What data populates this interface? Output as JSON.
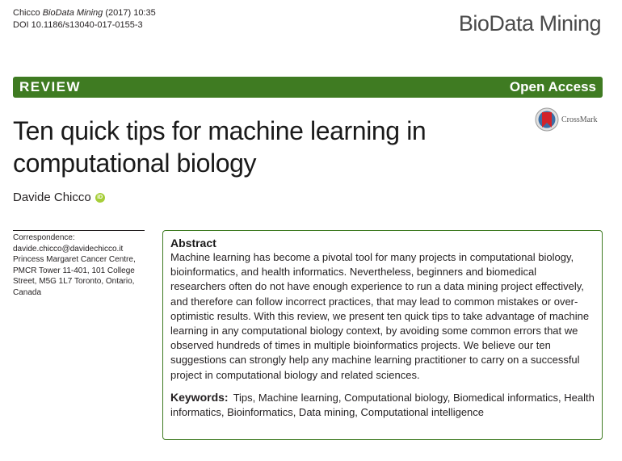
{
  "citation": {
    "author": "Chicco",
    "journal": "BioData Mining",
    "year_page": "(2017) 10:35",
    "doi": "DOI 10.1186/s13040-017-0155-3"
  },
  "journal_logo": "BioData Mining",
  "banner": {
    "article_type": "REVIEW",
    "access": "Open Access",
    "color": "#3f7b22"
  },
  "crossmark": {
    "label": "CrossMark",
    "icon": "crossmark-icon"
  },
  "title": "Ten quick tips for machine learning in computational biology",
  "author": {
    "name": "Davide Chicco",
    "orcid_icon": "orcid-icon"
  },
  "correspondence": {
    "label": "Correspondence:",
    "email": "davide.chicco@davidechicco.it",
    "address_lines": [
      "Princess Margaret Cancer Centre,",
      "PMCR Tower 11-401, 101 College",
      "Street, M5G 1L7 Toronto, Ontario,",
      "Canada"
    ]
  },
  "abstract": {
    "heading": "Abstract",
    "text": "Machine learning has become a pivotal tool for many projects in computational biology, bioinformatics, and health informatics. Nevertheless, beginners and biomedical researchers often do not have enough experience to run a data mining project effectively, and therefore can follow incorrect practices, that may lead to common mistakes or over-optimistic results. With this review, we present ten quick tips to take advantage of machine learning in any computational biology context, by avoiding some common errors that we observed hundreds of times in multiple bioinformatics projects. We believe our ten suggestions can strongly help any machine learning practitioner to carry on a successful project in computational biology and related sciences.",
    "keywords_label": "Keywords:",
    "keywords": "Tips, Machine learning, Computational biology, Biomedical informatics, Health informatics, Bioinformatics, Data mining, Computational intelligence"
  }
}
